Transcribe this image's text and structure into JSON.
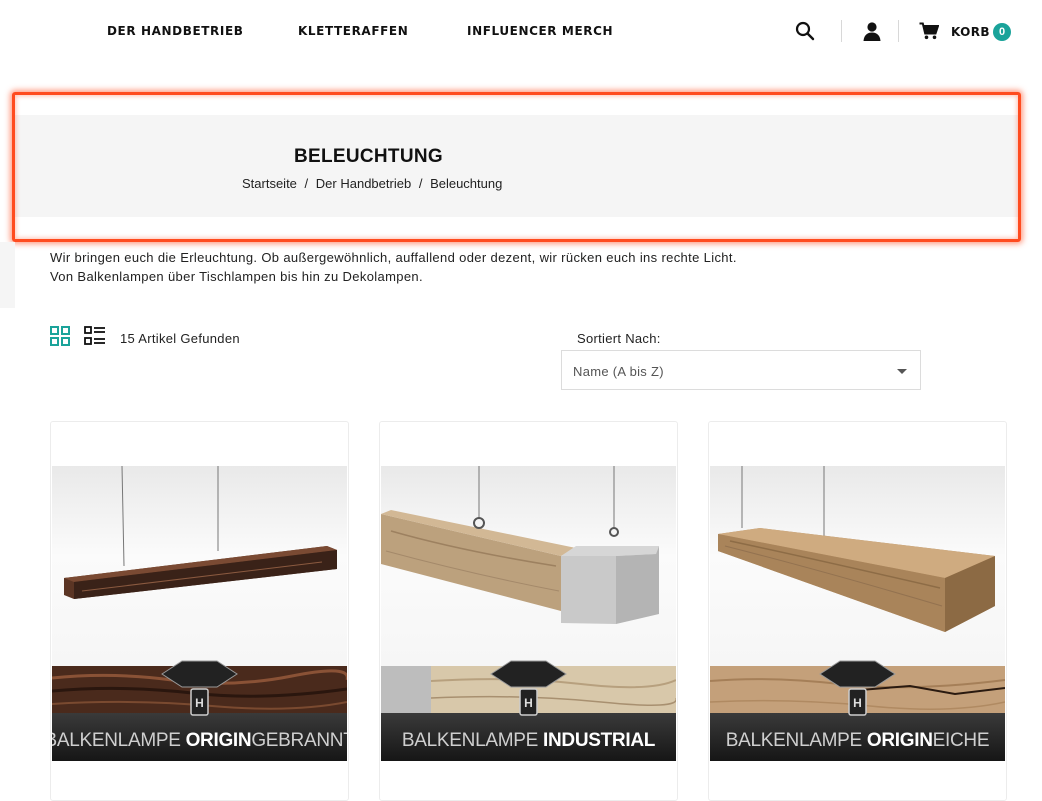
{
  "header": {
    "nav": [
      "DER HANDBETRIEB",
      "KLETTERAFFEN",
      "INFLUENCER MERCH"
    ],
    "cart_label": "KORB",
    "cart_count": "0"
  },
  "hero": {
    "title": "BELEUCHTUNG",
    "breadcrumb": [
      "Startseite",
      "Der Handbetrieb",
      "Beleuchtung"
    ],
    "separator": "/"
  },
  "description": {
    "line1": "Wir bringen euch die Erleuchtung. Ob außergewöhnlich, auffallend oder dezent, wir rücken euch ins rechte Licht.",
    "line2": "Von Balkenlampen über Tischlampen bis hin zu Dekolampen."
  },
  "toolbar": {
    "count_text": "15 Artikel Gefunden",
    "sort_label": "Sortiert Nach:",
    "sort_value": "Name (A bis Z)"
  },
  "products": [
    {
      "banner_prefix": "BALKENLAMPE ",
      "banner_bold": "ORIGIN",
      "banner_suffix": "GEBRANNT"
    },
    {
      "banner_prefix": "BALKENLAMPE ",
      "banner_bold": "INDUSTRIAL",
      "banner_suffix": ""
    },
    {
      "banner_prefix": "BALKENLAMPE ",
      "banner_bold": "ORIGIN",
      "banner_suffix": "EICHE"
    }
  ],
  "colors": {
    "accent": "#1aa39a",
    "highlight": "#ff4b1f",
    "hero_bg": "#f5f5f5"
  }
}
